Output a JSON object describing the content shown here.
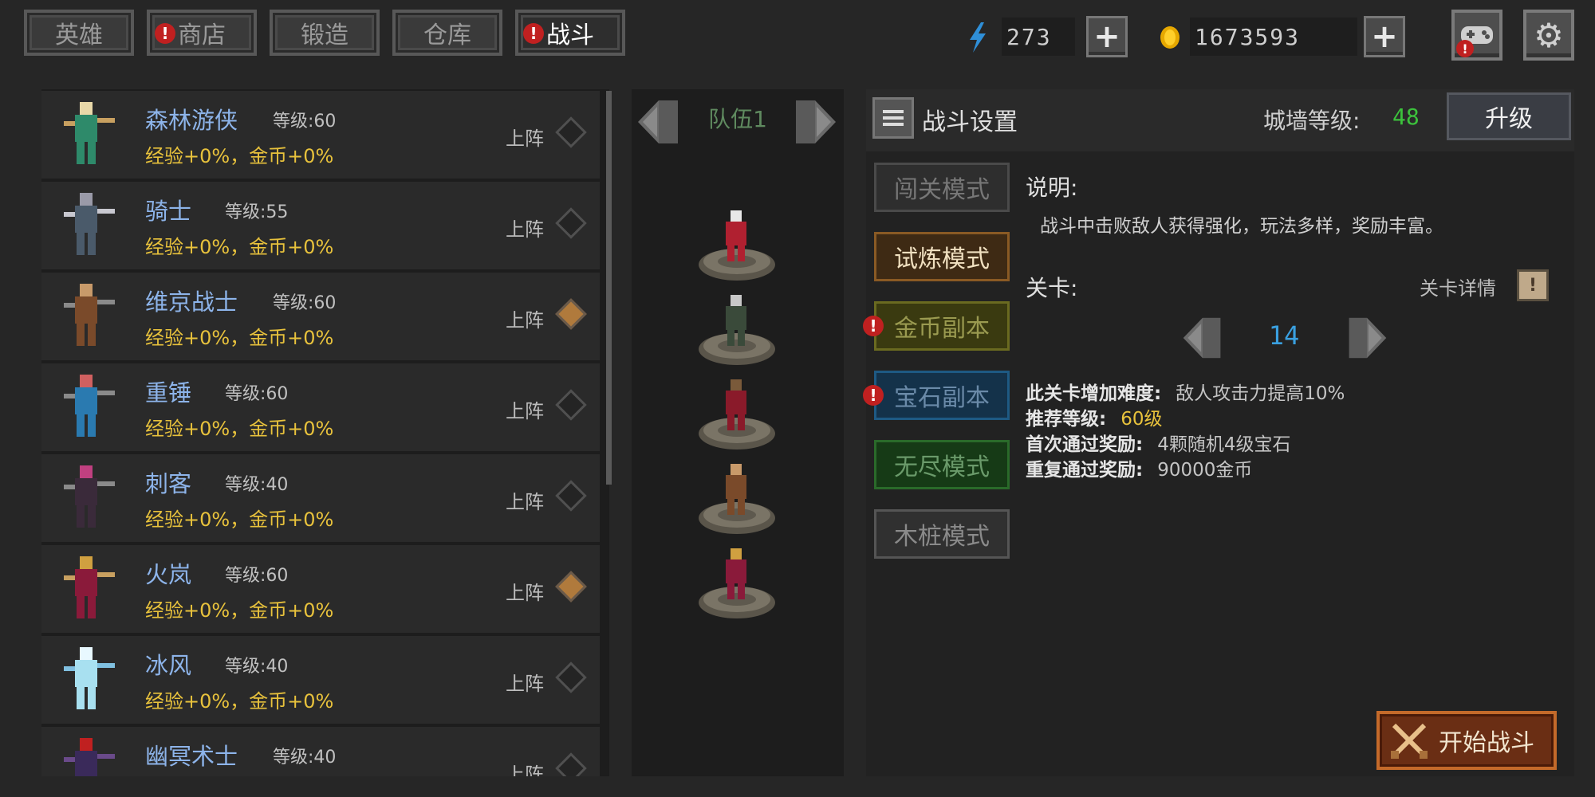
{
  "tabs": [
    {
      "label": "英雄",
      "alert": false,
      "active": false
    },
    {
      "label": "商店",
      "alert": true,
      "active": false
    },
    {
      "label": "锻造",
      "alert": false,
      "active": false
    },
    {
      "label": "仓库",
      "alert": false,
      "active": false
    },
    {
      "label": "战斗",
      "alert": true,
      "active": true
    }
  ],
  "resources": {
    "energy": "273",
    "energy_icon": "lightning-icon",
    "gold": "1673593",
    "gold_icon": "coin-icon"
  },
  "alert_mark": "!",
  "colors": {
    "hero_name": "#8db4ea",
    "bonus": "#e8c23c",
    "wall_level": "#3cc23c",
    "stage": "#3aa0e0",
    "recommend": "#e8c23c",
    "alert": "#c02020"
  },
  "heroes": [
    {
      "name": "森林游侠",
      "level": "等级:60",
      "bonus": "经验+0%，金币+0%",
      "deploy": "上阵",
      "selected": false
    },
    {
      "name": "骑士",
      "level": "等级:55",
      "bonus": "经验+0%，金币+0%",
      "deploy": "上阵",
      "selected": false
    },
    {
      "name": "维京战士",
      "level": "等级:60",
      "bonus": "经验+0%，金币+0%",
      "deploy": "上阵",
      "selected": true
    },
    {
      "name": "重锤",
      "level": "等级:60",
      "bonus": "经验+0%，金币+0%",
      "deploy": "上阵",
      "selected": false
    },
    {
      "name": "刺客",
      "level": "等级:40",
      "bonus": "经验+0%，金币+0%",
      "deploy": "上阵",
      "selected": false
    },
    {
      "name": "火岚",
      "level": "等级:60",
      "bonus": "经验+0%，金币+0%",
      "deploy": "上阵",
      "selected": true
    },
    {
      "name": "冰风",
      "level": "等级:40",
      "bonus": "经验+0%，金币+0%",
      "deploy": "上阵",
      "selected": false
    },
    {
      "name": "幽冥术士",
      "level": "等级:40",
      "bonus": "",
      "deploy": "上阵",
      "selected": false
    }
  ],
  "team": {
    "label": "队伍1"
  },
  "settings": {
    "title": "战斗设置",
    "wall_label": "城墙等级:",
    "wall_level": "48",
    "upgrade_label": "升级",
    "modes": [
      {
        "label": "闯关模式",
        "style": "gray-dim",
        "alert": false
      },
      {
        "label": "试炼模式",
        "style": "brown",
        "alert": false
      },
      {
        "label": "金币副本",
        "style": "olive",
        "alert": true
      },
      {
        "label": "宝石副本",
        "style": "blue",
        "alert": true
      },
      {
        "label": "无尽模式",
        "style": "green",
        "alert": false
      },
      {
        "label": "木桩模式",
        "style": "gray",
        "alert": false
      }
    ],
    "desc_label": "说明:",
    "desc_text": "战斗中击败敌人获得强化，玩法多样，奖励丰富。",
    "stage_label": "关卡:",
    "stage_detail_label": "关卡详情",
    "stage_number": "14",
    "difficulty_key": "此关卡增加难度:",
    "difficulty_val": "敌人攻击力提高10%",
    "recommend_key": "推荐等级:",
    "recommend_val": "60级",
    "first_reward_key": "首次通过奖励:",
    "first_reward_val": "4颗随机4级宝石",
    "repeat_reward_key": "重复通过奖励:",
    "repeat_reward_val": "90000金币",
    "start_label": "开始战斗"
  }
}
